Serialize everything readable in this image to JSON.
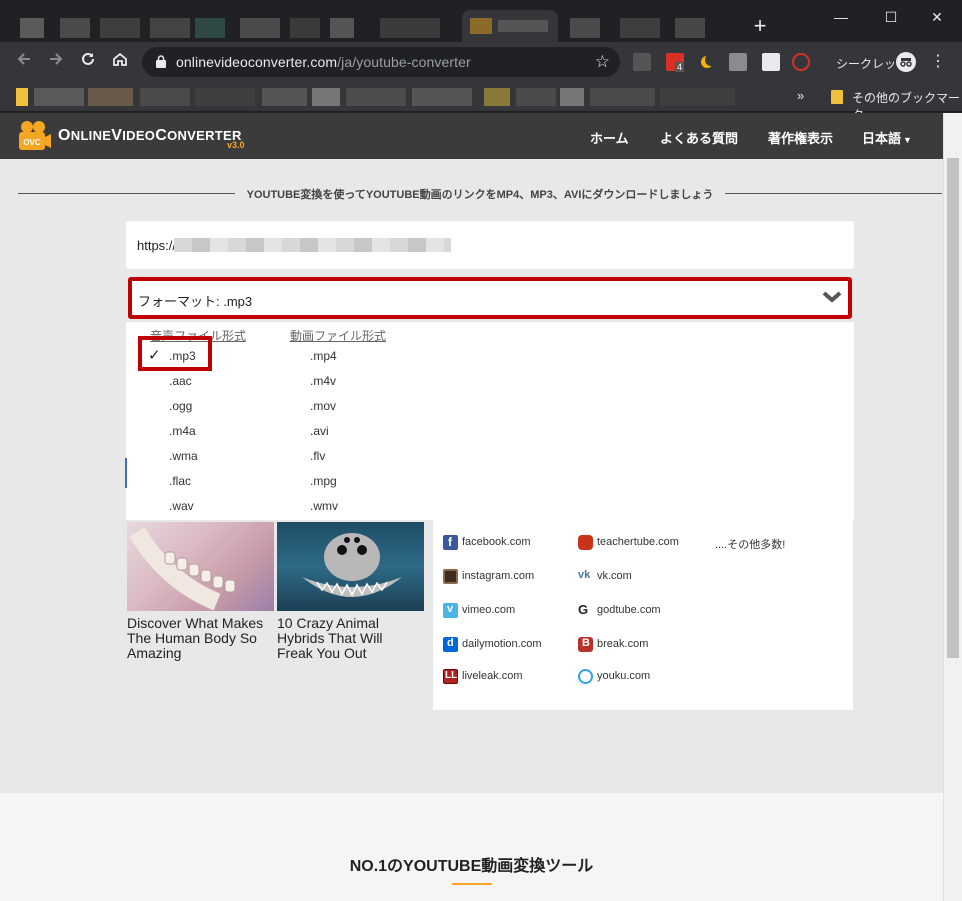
{
  "browser": {
    "new_tab": "+",
    "window_controls": {
      "minimize": "—",
      "maximize": "☐",
      "close": "✕"
    },
    "url_host": "onlinevideoconverter.com",
    "url_path": "/ja/youtube-converter",
    "incognito_label": "シークレット",
    "bookmarks_more": "»",
    "other_bookmarks": "その他のブックマーク",
    "extension_badges": {
      "ext1": "4"
    },
    "icons": [
      "back-icon",
      "forward-icon",
      "reload-icon",
      "home-icon",
      "lock-icon",
      "star-icon",
      "incognito-icon",
      "menu-icon"
    ]
  },
  "site": {
    "logo": {
      "badge": "OVC",
      "big_o": "O",
      "nline": "NLINE",
      "big_v": "V",
      "ideo": "IDEO",
      "big_c": "C",
      "onverter": "ONVERTER",
      "version": "v3.0"
    },
    "nav": {
      "home": "ホーム",
      "faq": "よくある質問",
      "copyright": "著作権表示",
      "language": "日本語"
    },
    "headline": "YOUTUBE変換を使ってYOUTUBE動画のリンクをMP4、MP3、AVIにダウンロードしましょう",
    "url_input": {
      "prefix": "https://"
    },
    "format_select": {
      "label": "フォーマット: .mp3"
    },
    "dropdown": {
      "audio_header": "音声ファイル形式",
      "video_header": "動画ファイル形式",
      "audio": [
        ".mp3",
        ".aac",
        ".ogg",
        ".m4a",
        ".wma",
        ".flac",
        ".wav"
      ],
      "video": [
        ".mp4",
        ".m4v",
        ".mov",
        ".avi",
        ".flv",
        ".mpg",
        ".wmv"
      ],
      "selected": ".mp3"
    },
    "ads": [
      {
        "title_lines": [
          "Discover What Makes",
          "The Human Body So",
          "Amazing"
        ]
      },
      {
        "title_lines": [
          "10 Crazy Animal",
          "Hybrids That Will",
          "Freak You Out"
        ]
      }
    ],
    "supported_sites": {
      "col1": [
        "facebook.com",
        "instagram.com",
        "vimeo.com",
        "dailymotion.com",
        "liveleak.com"
      ],
      "col2": [
        "teachertube.com",
        "vk.com",
        "godtube.com",
        "break.com",
        "youku.com"
      ],
      "more": "....その他多数!"
    },
    "bottom_title": "NO.1のYOUTUBE動画変換ツール",
    "colors": {
      "accent": "#f5a623",
      "highlight": "#c00000",
      "header_bg": "#3b3b3b"
    }
  }
}
